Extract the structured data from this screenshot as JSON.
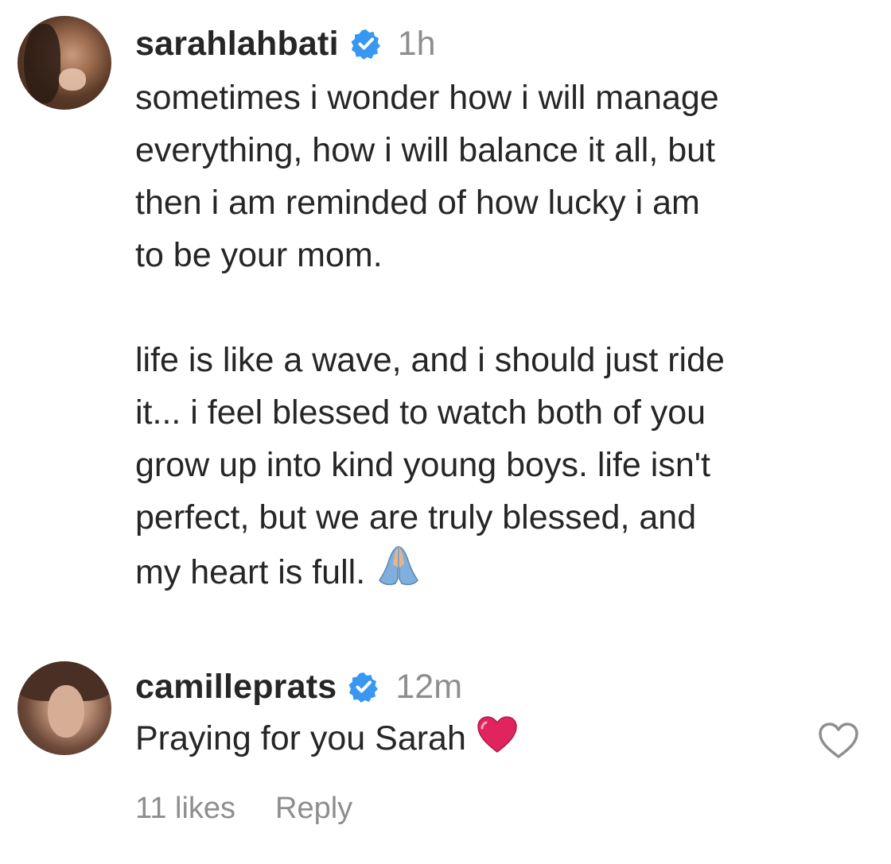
{
  "caption": {
    "username": "sarahlahbati",
    "time": "1h",
    "paragraph_1": [
      "sometimes i wonder how i will manage",
      "everything, how i will balance it all, but",
      "then i am reminded of how lucky i am",
      "to be your mom."
    ],
    "paragraph_2": [
      "life is like a wave, and i should just ride",
      "it... i feel blessed to watch both of you",
      "grow up into kind young boys. life isn't",
      "perfect, but we are truly blessed, and",
      "my heart is full."
    ],
    "emoji": "folded-hands"
  },
  "reply": {
    "username": "camilleprats",
    "time": "12m",
    "text": "Praying for you Sarah",
    "emoji": "red-heart",
    "likes_label": "11 likes",
    "reply_label": "Reply"
  },
  "colors": {
    "text": "#262626",
    "muted": "#8e8e8e",
    "verified": "#3897f0",
    "heart": "#e0245e"
  }
}
